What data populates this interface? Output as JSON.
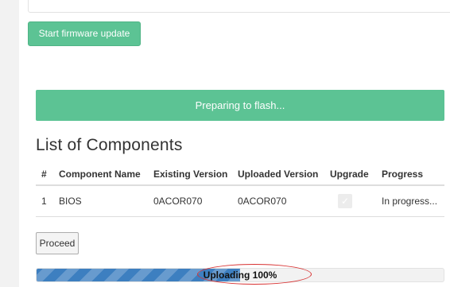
{
  "toolbar": {
    "start_update_label": "Start firmware update"
  },
  "status": {
    "flash_message": "Preparing to flash..."
  },
  "components": {
    "title": "List of Components",
    "columns": [
      "#",
      "Component Name",
      "Existing Version",
      "Uploaded Version",
      "Upgrade",
      "Progress"
    ],
    "rows": [
      {
        "index": "1",
        "name": "BIOS",
        "existing_version": "0ACOR070",
        "uploaded_version": "0ACOR070",
        "upgrade_checked": true,
        "progress": "In progress..."
      }
    ]
  },
  "actions": {
    "proceed_label": "Proceed"
  },
  "upload": {
    "label": "Uploading 100%",
    "fill_fraction": 0.5
  },
  "colors": {
    "accent_green": "#5cc394",
    "progress_blue": "#3d7fc0",
    "annotation_red": "#d83232"
  },
  "icons": {
    "upgrade_checkbox": "check-icon"
  }
}
